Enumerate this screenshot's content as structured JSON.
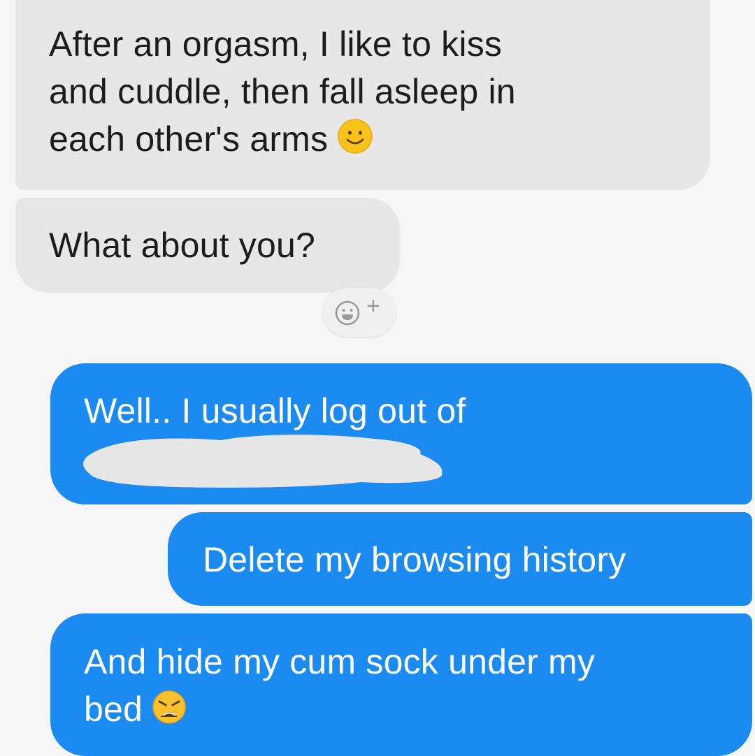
{
  "incoming_messages": [
    {
      "lines": [
        "After an orgasm, I like to kiss",
        "and cuddle, then fall asleep in",
        "each other's arms"
      ],
      "emoji": "slightly-smiling-face-icon"
    },
    {
      "lines": [
        "What about you?"
      ]
    }
  ],
  "reaction_button": {
    "icon": "add-reaction-icon",
    "plus": "+"
  },
  "outgoing_messages": [
    {
      "lines": [
        "Well.. I usually log out of"
      ],
      "redacted": true
    },
    {
      "lines": [
        "Delete my browsing history"
      ]
    },
    {
      "lines": [
        "And hide my cum sock under my",
        "bed"
      ],
      "emoji": "weary-face-icon"
    }
  ],
  "colors": {
    "incoming_bubble": "#e7e7e7",
    "outgoing_bubble": "#1b8af1",
    "background": "#f6f6f6"
  }
}
